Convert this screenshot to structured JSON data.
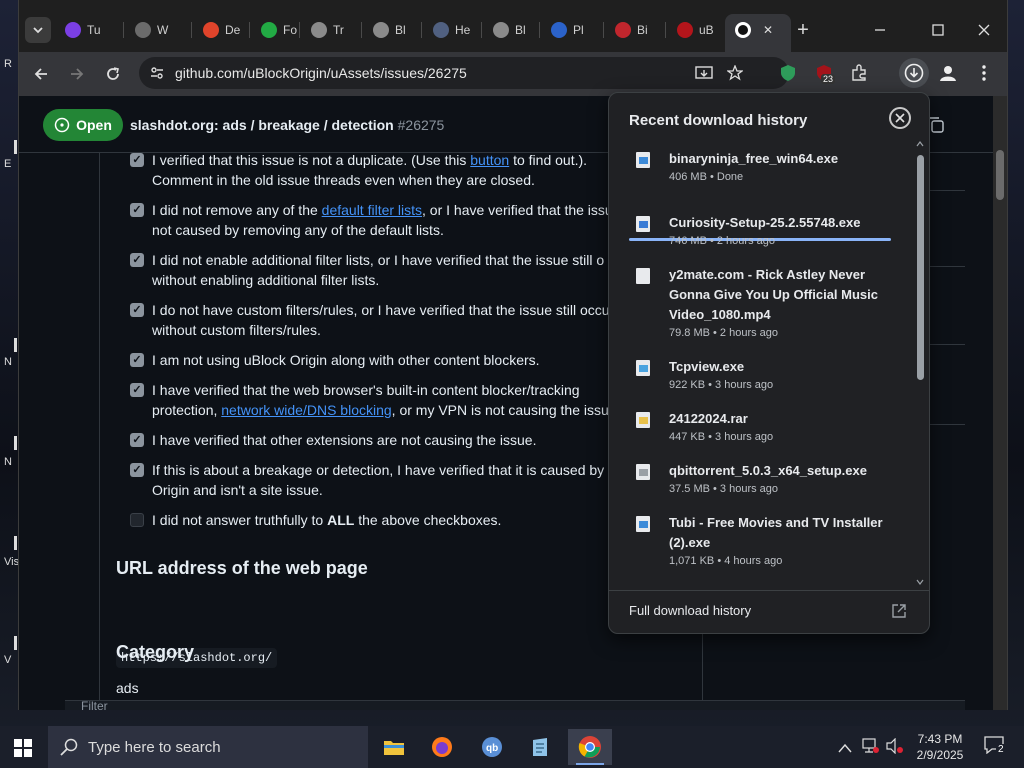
{
  "desktop": {
    "labels": [
      "R",
      "E",
      "N",
      "N",
      "Vis",
      "V"
    ]
  },
  "tabs": [
    {
      "label": "Tu",
      "favicon": "twitch-like-icon",
      "color": "#7b3fe4"
    },
    {
      "label": "W",
      "favicon": "brave-lion-icon",
      "color": "#6b6b6b"
    },
    {
      "label": "De",
      "favicon": "x-logo-icon",
      "color": "#e0442b"
    },
    {
      "label": "Fo",
      "favicon": "green-dot-icon",
      "color": "#22aa44"
    },
    {
      "label": "Tr",
      "favicon": "globe-icon",
      "color": "#8a8a8a"
    },
    {
      "label": "Bl",
      "favicon": "globe-icon",
      "color": "#8a8a8a"
    },
    {
      "label": "He",
      "favicon": "portrait-icon",
      "color": "#506080"
    },
    {
      "label": "Bl",
      "favicon": "globe-icon",
      "color": "#8a8a8a"
    },
    {
      "label": "Pl",
      "favicon": "500-badge-icon",
      "color": "#2b62c9"
    },
    {
      "label": "Bi",
      "favicon": "red-face-icon",
      "color": "#c0262d"
    },
    {
      "label": "uB",
      "favicon": "ublock-icon",
      "color": "#b3151b"
    },
    {
      "label": "",
      "favicon": "github-icon",
      "color": "#ffffff",
      "active": true
    }
  ],
  "toolbar": {
    "url": "github.com/uBlockOrigin/uAssets/issues/26275",
    "ext_badge": "23"
  },
  "issue": {
    "status": "Open",
    "title": "slashdot.org: ads / breakage / detection",
    "number": "#26275",
    "checks": [
      {
        "pre": "I verified that this issue is not a duplicate. (Use this ",
        "link": "button",
        "post": " to find out.).",
        "line2": "Comment in the old issue threads even when they are closed.",
        "checked": true
      },
      {
        "pre": "I did not remove any of the ",
        "link": "default filter lists",
        "post": ", or I have verified that the issue is",
        "line2": "not caused by removing any of the default lists.",
        "checked": true
      },
      {
        "pre": "I did not enable additional filter lists, or I have verified that the issue still o",
        "link": "",
        "post": "",
        "line2": "without enabling additional filter lists.",
        "checked": true
      },
      {
        "pre": "I do not have custom filters/rules, or I have verified that the issue still occu",
        "link": "",
        "post": "",
        "line2": "without custom filters/rules.",
        "checked": true
      },
      {
        "pre": "I am not using uBlock Origin along with other content blockers.",
        "link": "",
        "post": "",
        "line2": "",
        "checked": true
      },
      {
        "pre": "I have verified that the web browser's built-in content blocker/tracking",
        "link": "",
        "post": "",
        "line2_pre": "protection, ",
        "line2_link": "network wide/DNS blocking",
        "line2_post": ", or my VPN is not causing the issu",
        "checked": true
      },
      {
        "pre": "I have verified that other extensions are not causing the issue.",
        "link": "",
        "post": "",
        "line2": "",
        "checked": true
      },
      {
        "pre": "If this is about a breakage or detection, I have verified that it is caused by u",
        "link": "",
        "post": "",
        "line2": "Origin and isn't a site issue.",
        "checked": true
      },
      {
        "pre": "I did not answer truthfully to ",
        "bold": "ALL",
        "post": " the above checkboxes.",
        "line2": "",
        "checked": false
      }
    ],
    "url_heading": "URL address of the web page",
    "url_value": "https://slashdot.org/",
    "category_heading": "Category",
    "category_value": "ads",
    "filter_hint": "Filter"
  },
  "downloads": {
    "title": "Recent download history",
    "items": [
      {
        "name": "binaryninja_free_win64.exe",
        "meta": "406 MB • Done",
        "icon": "exe-file-icon",
        "color": "#3c8ad8"
      },
      {
        "name": "Curiosity-Setup-25.2.55748.exe",
        "meta": "746 MB • 2 hours ago",
        "icon": "installer-icon",
        "color": "#3a7bd5"
      },
      {
        "name": "y2mate.com - Rick Astley  Never Gonna Give You Up Official Music Video_1080.mp4",
        "meta": "79.8 MB • 2 hours ago",
        "icon": "video-file-icon",
        "color": "#e8eaed"
      },
      {
        "name": "Tcpview.exe",
        "meta": "922 KB • 3 hours ago",
        "icon": "tcpview-icon",
        "color": "#4aa3df"
      },
      {
        "name": "24122024.rar",
        "meta": "447 KB • 3 hours ago",
        "icon": "rar-archive-icon",
        "color": "#e8c14a"
      },
      {
        "name": "qbittorrent_5.0.3_x64_setup.exe",
        "meta": "37.5 MB • 3 hours ago",
        "icon": "qbittorrent-icon",
        "color": "#9aa0a6"
      },
      {
        "name": "Tubi - Free Movies and TV Installer (2).exe",
        "meta": "1,071 KB • 4 hours ago",
        "icon": "exe-file-icon",
        "color": "#3c8ad8"
      }
    ],
    "footer": "Full download history"
  },
  "taskbar": {
    "search_placeholder": "Type here to search",
    "time": "7:43 PM",
    "date": "2/9/2025",
    "notifications": "2"
  }
}
